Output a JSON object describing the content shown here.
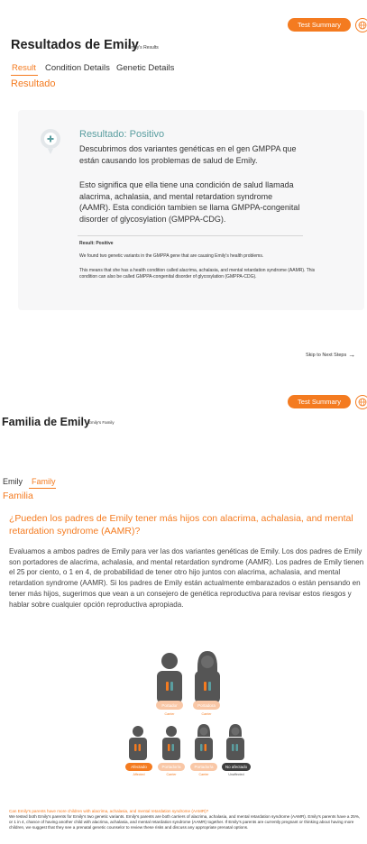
{
  "section1": {
    "summary_button": "Test Summary",
    "title": "Resultados de Emily",
    "subtitle": "Emily's Results",
    "tabs": [
      "Result",
      "Condition Details",
      "Genetic Details"
    ],
    "section_heading": "Resultado",
    "card": {
      "heading": "Resultado: Positivo",
      "p1": "Descubrimos dos variantes genéticas en el gen GMPPA que están causando los problemas de salud de Emily.",
      "p2": "Esto significa que ella tiene una condición de salud llamada alacrima, achalasia, and mental retardation syndrome (AAMR). Esta condición tambien se llama GMPPA-congenital disorder of glycosylation (GMPPA-CDG).",
      "en_heading": "Result: Positive",
      "en_p1": "We found two genetic variants in the GMPPA gene that are causing Emily's health problems.",
      "en_p2": "This means that she has a health condition called alacrima, achalasia, and mental retardation syndrome (AAMR). This condition can also be called GMPPA-congenital disorder of glycosylation (GMPPA-CDG)."
    },
    "skip_link": "Skip to Next Steps",
    "skip_arrow": "→"
  },
  "section2": {
    "summary_button": "Test Summary",
    "title": "Familia de Emily",
    "subtitle": "Emily's Family",
    "tabs": [
      "Emily",
      "Family"
    ],
    "section_heading": "Familia",
    "question": "¿Pueden los padres de Emily tener más hijos con alacrima, achalasia, and mental retardation syndrome (AAMR)?",
    "paragraph": "Evaluamos a ambos padres de Emily para ver las dos variantes genéticas de Emily. Los dos padres de Emily son portadores de alacrima, achalasia, and mental retardation syndrome (AAMR). Los padres de Emily tienen el 25 por ciento, o 1 en 4, de probabilidad de tener otro hijo juntos con alacrima, achalasia, and mental retardation syndrome (AAMR). Si los padres de Emily están actualmente embarazados o están pensando en tener más hijos, sugerimos que vean a un consejero de genética reproductiva para revisar estos riesgos y hablar sobre cualquier opción reproductiva apropiada.",
    "parents": [
      {
        "label": "Portador",
        "sub": "Carrier"
      },
      {
        "label": "Portadora",
        "sub": "Carrier"
      }
    ],
    "children": [
      {
        "label": "Afectado",
        "sub": "Affected",
        "style": "affected"
      },
      {
        "label": "Portador/a",
        "sub": "Carrier",
        "style": "carrier"
      },
      {
        "label": "Portador/a",
        "sub": "Carrier",
        "style": "carrier"
      },
      {
        "label": "No afectado",
        "sub": "Unaffected",
        "style": "unaffected"
      }
    ],
    "en_question": "Can Emily's parents have more children with alacrima, achalasia, and mental retardation syndrome (AAMR)?",
    "en_paragraph": "We tested both Emily's parents for Emily's two genetic variants. Emily's parents are both carriers of alacrima, achalasia, and mental retardation syndrome (AAMR). Emily's parents have a 25%, or 1 in 4, chance of having another child with alacrima, achalasia, and mental retardation syndrome (AAMR) together. If Emily's parents are currently pregnant or thinking about having more children, we suggest that they see a prenatal genetic counselor to review these risks and discuss any appropriate prenatal options."
  },
  "colors": {
    "accent": "#f47b20",
    "teal": "#5a9ea0",
    "carrier_pill": "#f9c7a6",
    "dark_pill": "#3f3f3f",
    "figure": "#555555"
  }
}
